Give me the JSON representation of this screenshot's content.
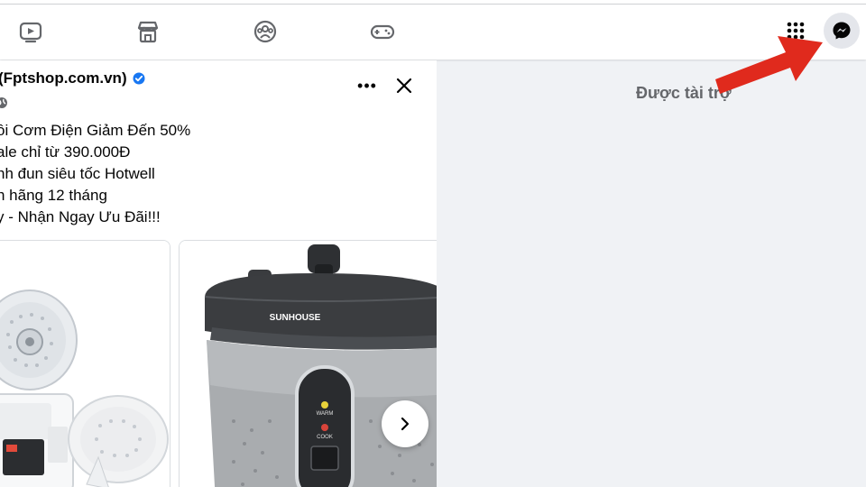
{
  "topbar": {
    "icons": [
      "watch-icon",
      "marketplace-icon",
      "groups-icon",
      "gaming-icon"
    ],
    "menu_icon": "grid-menu-icon",
    "messenger_icon": "messenger-icon"
  },
  "post": {
    "author": "(Fptshop.com.vn)",
    "lines": [
      "ồi Cơm Điện Giảm Đến 50%",
      "ale chỉ từ 390.000Đ",
      "nh đun siêu tốc Hotwell",
      "h hãng 12 tháng",
      "y - Nhận Ngay Ưu Đãi!!!"
    ],
    "product_brand": "SUNHOUSE",
    "panel_warm": "WARM",
    "panel_cook": "COOK",
    "more_label": "•••"
  },
  "sidebar": {
    "sponsored": "Được tài trợ"
  },
  "colors": {
    "accent": "#1877f2",
    "annotation_arrow": "#e02a1d",
    "background": "#f0f2f5"
  }
}
